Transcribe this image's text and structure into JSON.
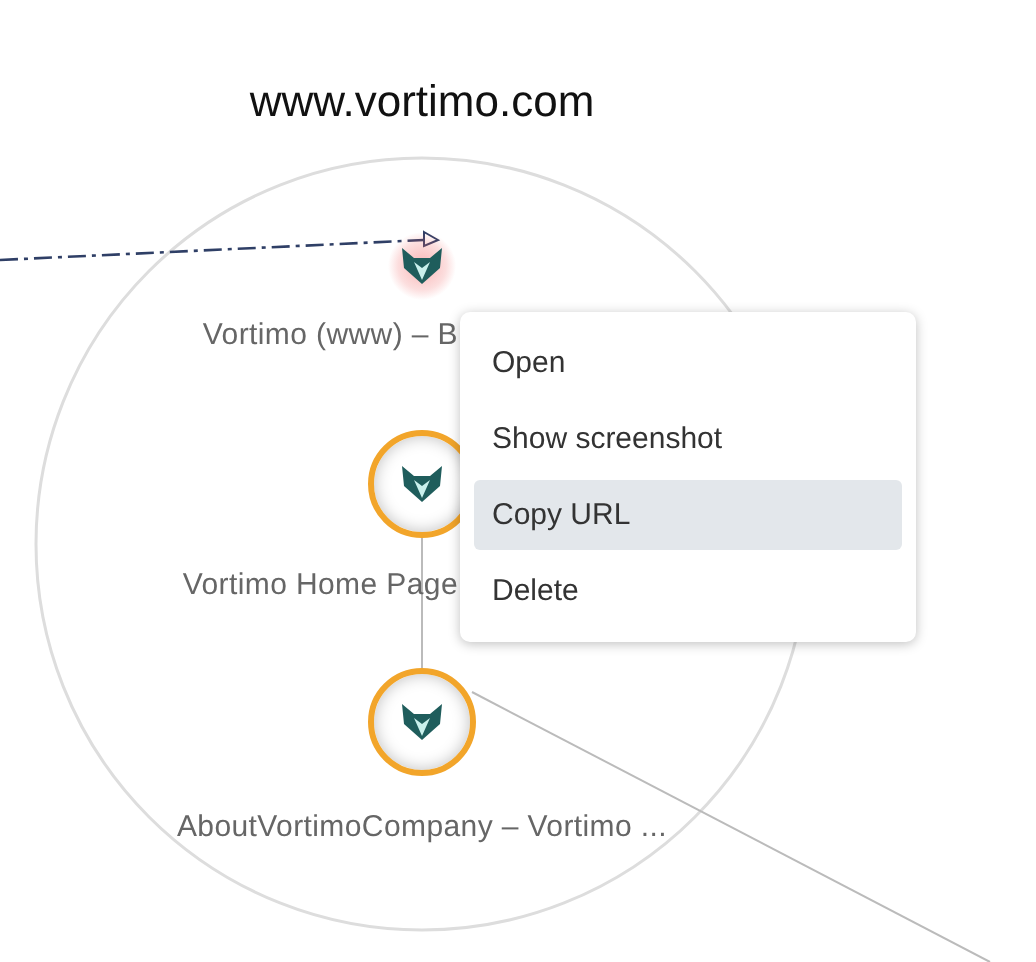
{
  "group": {
    "title": "www.vortimo.com"
  },
  "nodes": [
    {
      "label": "Vortimo (www) – B",
      "kind": "glow"
    },
    {
      "label": "Vortimo Home Page",
      "kind": "ring"
    },
    {
      "label": "AboutVortimoCompany – Vortimo ...",
      "kind": "ring"
    }
  ],
  "context_menu": {
    "items": [
      {
        "label": "Open",
        "selected": false
      },
      {
        "label": "Show screenshot",
        "selected": false
      },
      {
        "label": "Copy URL",
        "selected": true
      },
      {
        "label": "Delete",
        "selected": false
      }
    ]
  }
}
